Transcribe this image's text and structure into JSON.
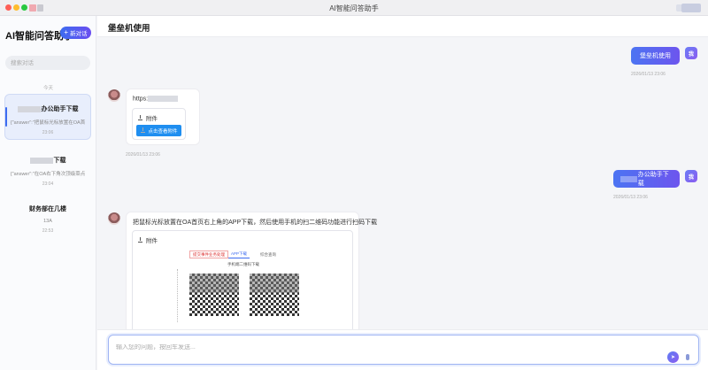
{
  "window": {
    "title": "AI智能问答助手"
  },
  "sidebar": {
    "app_name": "AI智能问答助手",
    "new_button": "新对话",
    "search_placeholder": "搜索对话",
    "group_label": "今天",
    "conversations": [
      {
        "title": "办公助手下载",
        "snippet": "{\"answer\":\"把鼠标光标放置在OA首",
        "time": "23:06"
      },
      {
        "title": "下载",
        "snippet": "{\"answer\":\"在OA右下角次顶级菜点",
        "time": "23:04"
      },
      {
        "title": "财务部在几楼",
        "snippet": "13A",
        "time": "22:53"
      }
    ]
  },
  "header": {
    "title": "堡垒机使用"
  },
  "chat": {
    "messages": [
      {
        "role": "user",
        "text": "堡垒机使用",
        "time": "2026/01/13 23:06"
      },
      {
        "role": "bot",
        "link_prefix": "https:",
        "attach_label": "附件",
        "download_button": "点击查看附件",
        "time": "2026/01/13 23:06"
      },
      {
        "role": "user",
        "text": "办公助手下载",
        "time": "2026/01/13 23:06"
      },
      {
        "role": "bot",
        "text": "把鼠标光标放置在OA首页右上角的APP下载，然后使用手机的扫二维码功能进行扫码下载",
        "attach_label": "附件",
        "image": {
          "tabs": [
            "提交事件业务处理",
            "APP下载",
            "综合查询"
          ],
          "subtitle": "手机端二维码下载"
        }
      }
    ],
    "user_avatar_label": "我"
  },
  "input": {
    "placeholder": "输入您的问题，按回车发送..."
  }
}
